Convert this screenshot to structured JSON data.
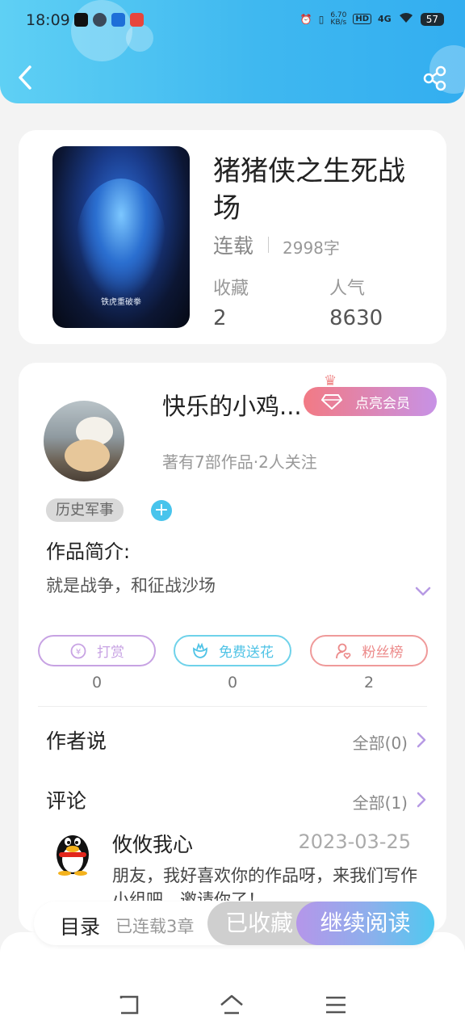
{
  "status_bar": {
    "time": "18:09",
    "net_speed_value": "6.70",
    "net_speed_unit": "KB/s",
    "hd_label": "HD",
    "signal_label": "4G",
    "battery": "57"
  },
  "header": {
    "back_icon": "chevron-left-icon",
    "share_icon": "share-icon"
  },
  "book": {
    "title": "猪猪侠之生死战场",
    "status": "连载",
    "word_count": "2998字",
    "favorites_label": "收藏",
    "favorites_value": "2",
    "popularity_label": "人气",
    "popularity_value": "8630",
    "cover_caption": "铁虎重破拳"
  },
  "author": {
    "name": "快乐的小鸡...",
    "meta": "著有7部作品·2人关注",
    "vip_button": "点亮会员"
  },
  "tags": {
    "genre": "历史军事",
    "add_symbol": "+"
  },
  "intro": {
    "title": "作品简介:",
    "text": "就是战争，和征战沙场"
  },
  "actions": {
    "tip_label": "打赏",
    "tip_count": "0",
    "flower_label": "免费送花",
    "flower_count": "0",
    "fans_label": "粉丝榜",
    "fans_count": "2"
  },
  "author_says": {
    "title": "作者说",
    "link": "全部(0)"
  },
  "comments": {
    "title": "评论",
    "link": "全部(1)",
    "items": [
      {
        "user": "攸攸我心",
        "date": "2023-03-25",
        "text": "朋友，我好喜欢你的作品呀，来我们写作小组吧，邀请你了！"
      }
    ]
  },
  "bottom_bar": {
    "toc_label": "目录",
    "chapters": "已连载3章",
    "collected_label": "已收藏",
    "read_label": "继续阅读"
  },
  "colors": {
    "header_gradient": [
      "#5fd0f4",
      "#33aef0"
    ],
    "vip_gradient": [
      "#f27a84",
      "#c792e6"
    ],
    "tip_color": "#c7a2e3",
    "flower_color": "#6fd2ea",
    "fans_color": "#ef9a9a",
    "read_gradient": [
      "#b596ea",
      "#4fc9f0"
    ]
  }
}
